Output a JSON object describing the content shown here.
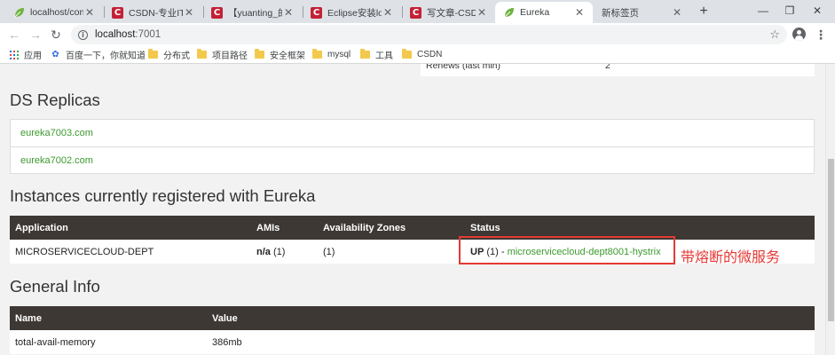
{
  "browser": {
    "tabs": [
      {
        "title": "localhost/conc",
        "icon": "spring-leaf-icon"
      },
      {
        "title": "CSDN-专业IT技",
        "icon": "csdn-icon"
      },
      {
        "title": "【yuanting_的",
        "icon": "csdn-icon"
      },
      {
        "title": "Eclipse安装lom",
        "icon": "csdn-icon"
      },
      {
        "title": "写文章-CSDN博",
        "icon": "csdn-icon"
      },
      {
        "title": "Eureka",
        "icon": "spring-leaf-icon",
        "active": true
      },
      {
        "title": "新标签页",
        "icon": ""
      }
    ],
    "new_tab": "+",
    "window_controls": {
      "minimize": "—",
      "restore": "❐",
      "close": "✕"
    },
    "address": {
      "host": "localhost",
      "port": ":7001"
    },
    "bookmarks": [
      {
        "label": "应用",
        "icon": "apps-icon"
      },
      {
        "label": "百度一下，你就知道",
        "icon": "baidu-icon"
      },
      {
        "label": "分布式",
        "icon": "folder-icon"
      },
      {
        "label": "项目路径",
        "icon": "folder-icon"
      },
      {
        "label": "安全框架",
        "icon": "folder-icon"
      },
      {
        "label": "mysql",
        "icon": "folder-icon"
      },
      {
        "label": "工具",
        "icon": "folder-icon"
      },
      {
        "label": "CSDN",
        "icon": "folder-icon"
      }
    ]
  },
  "page": {
    "renews_row": {
      "label": "Renews (last min)",
      "value": "2"
    },
    "ds_replicas": {
      "title": "DS Replicas",
      "items": [
        "eureka7003.com",
        "eureka7002.com"
      ]
    },
    "instances": {
      "title": "Instances currently registered with Eureka",
      "headers": [
        "Application",
        "AMIs",
        "Availability Zones",
        "Status"
      ],
      "rows": [
        {
          "application": "MICROSERVICECLOUD-DEPT",
          "amis_label": "n/a",
          "amis_count": "(1)",
          "zones": "(1)",
          "status_up": "UP",
          "status_count": "(1) -",
          "status_link": "microservicecloud-dept8001-hystrix"
        }
      ]
    },
    "annotation": "带熔断的微服务",
    "general_info": {
      "title": "General Info",
      "headers": [
        "Name",
        "Value"
      ],
      "rows": [
        {
          "name": "total-avail-memory",
          "value": "386mb"
        }
      ]
    }
  },
  "colors": {
    "table_header": "#3d3834",
    "link_green": "#3c9a2e",
    "highlight_red": "#e53935",
    "page_bg": "#f2f2f2"
  }
}
